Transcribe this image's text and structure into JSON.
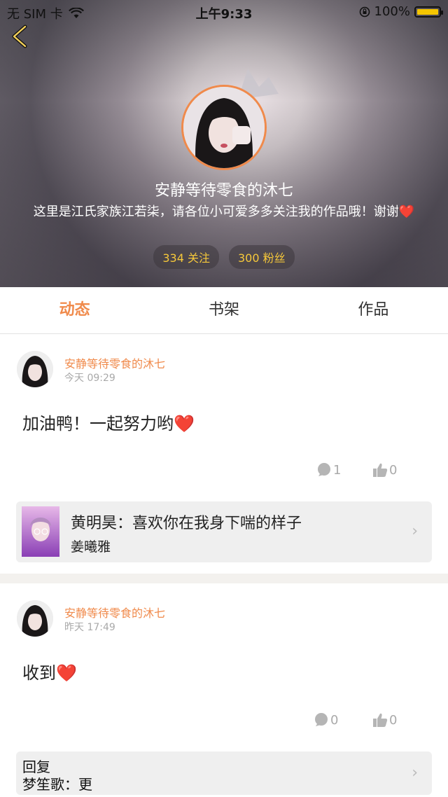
{
  "status_bar": {
    "carrier": "无 SIM 卡",
    "time": "上午9:33",
    "battery": "100%"
  },
  "profile": {
    "name": "安静等待零食的沐七",
    "bio": "这里是江氏家族江若柒，请各位小可爱多多关注我的作品哦！谢谢❤️",
    "following_label": "334 关注",
    "fans_label": "300 粉丝"
  },
  "tabs": [
    {
      "label": "动态",
      "active": true
    },
    {
      "label": "书架",
      "active": false
    },
    {
      "label": "作品",
      "active": false
    }
  ],
  "posts": [
    {
      "author": "安静等待零食的沐七",
      "time": "今天 09:29",
      "content": "加油鸭！一起努力哟❤️",
      "comments": "1",
      "likes": "0",
      "ref": {
        "title": "黄明昊：喜欢你在我身下喘的样子",
        "subtitle": "姜曦雅"
      }
    },
    {
      "author": "安静等待零食的沐七",
      "time": "昨天 17:49",
      "content": "收到❤️",
      "comments": "0",
      "likes": "0",
      "ref": {
        "title": "回复",
        "subtitle": "梦笙歌：更"
      }
    }
  ],
  "colors": {
    "accent": "#f08a4b",
    "pill_text": "#f6c83a",
    "card_bg": "#efefef"
  }
}
